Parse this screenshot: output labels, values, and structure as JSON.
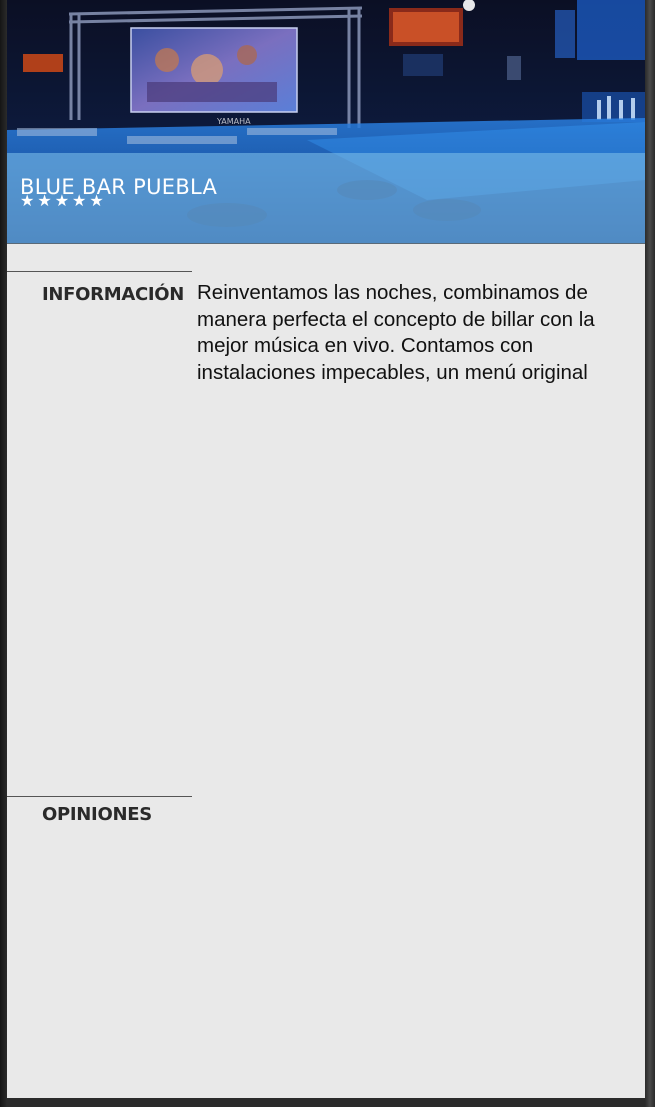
{
  "venue": {
    "name": "BLUE BAR PUEBLA",
    "rating": 5,
    "stars": [
      "★",
      "★",
      "★",
      "★",
      "★"
    ]
  },
  "sections": {
    "info": {
      "label": "INFORMACIÓN",
      "text": "Reinventamos las noches, combinamos de manera perfecta el concepto de billar con la mejor música en vivo. Contamos con instalaciones impecables, un menú original"
    },
    "reviews": {
      "label": "OPINIONES"
    }
  },
  "hero_image": {
    "screen_brand": "YAMAHA"
  },
  "colors": {
    "overlay": "#78b9e6",
    "card": "#e9e9e9",
    "frame": "#2b2b2b",
    "text": "#111111"
  }
}
